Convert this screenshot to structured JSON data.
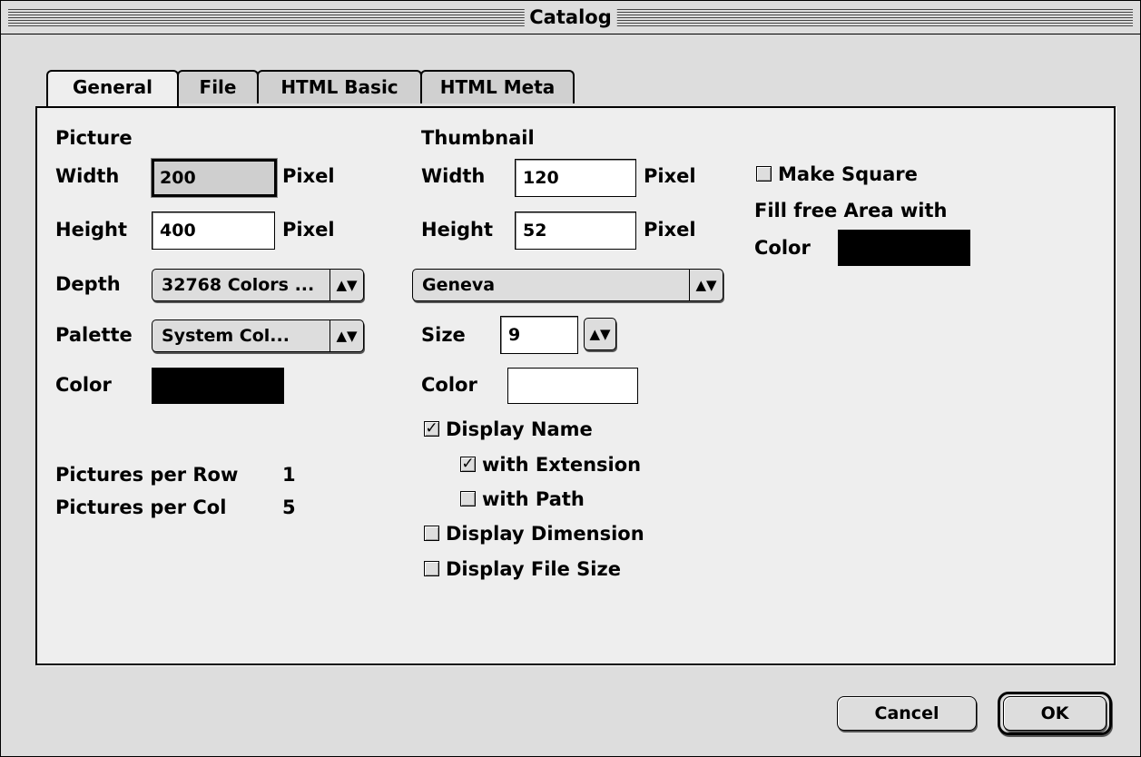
{
  "window": {
    "title": "Catalog"
  },
  "tabs": [
    "General",
    "File",
    "HTML Basic",
    "HTML Meta"
  ],
  "picture": {
    "heading": "Picture",
    "width_label": "Width",
    "width_value": "200",
    "width_unit": "Pixel",
    "height_label": "Height",
    "height_value": "400",
    "height_unit": "Pixel",
    "depth_label": "Depth",
    "depth_value": "32768 Colors ...",
    "palette_label": "Palette",
    "palette_value": "System Col...",
    "color_label": "Color",
    "color_value": "#000000",
    "per_row_label": "Pictures per Row",
    "per_row_value": "1",
    "per_col_label": "Pictures per Col",
    "per_col_value": "5"
  },
  "thumbnail": {
    "heading": "Thumbnail",
    "width_label": "Width",
    "width_value": "120",
    "width_unit": "Pixel",
    "height_label": "Height",
    "height_value": "52",
    "height_unit": "Pixel",
    "font_value": "Geneva",
    "size_label": "Size",
    "size_value": "9",
    "color_label": "Color",
    "color_value": "#ffffff",
    "display_name": {
      "label": "Display Name",
      "checked": true
    },
    "with_extension": {
      "label": "with Extension",
      "checked": true
    },
    "with_path": {
      "label": "with Path",
      "checked": false
    },
    "display_dimension": {
      "label": "Display Dimension",
      "checked": false
    },
    "display_file_size": {
      "label": "Display File Size",
      "checked": false
    }
  },
  "square": {
    "make_square": {
      "label": "Make Square",
      "checked": false
    },
    "fill_label": "Fill free Area with",
    "color_label": "Color",
    "color_value": "#000000"
  },
  "buttons": {
    "cancel": "Cancel",
    "ok": "OK"
  },
  "icons": {
    "checkmark": "☑",
    "popup_arrows": "▲▼"
  }
}
